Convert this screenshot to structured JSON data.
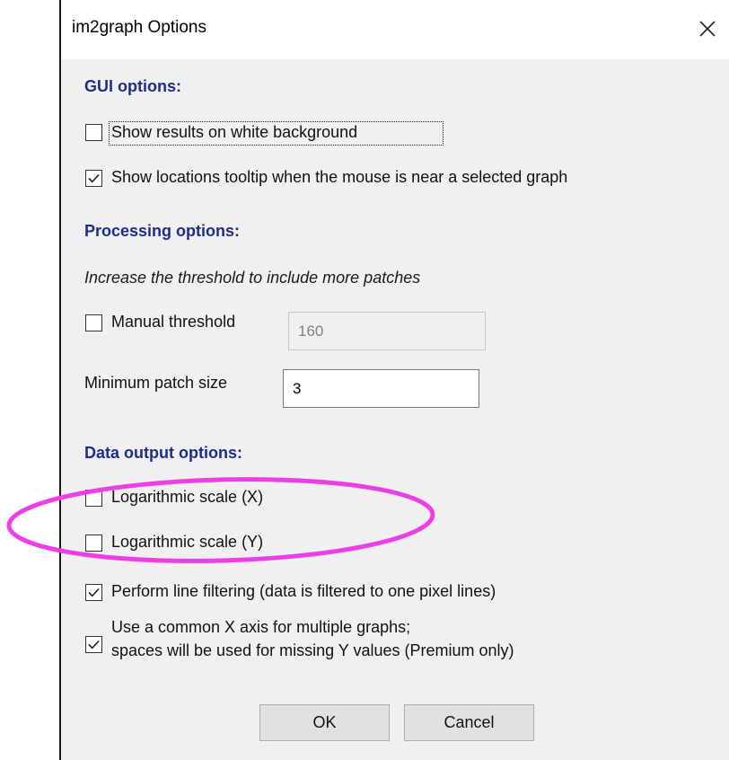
{
  "window": {
    "title": "im2graph Options",
    "close_icon": "close-icon"
  },
  "gui_options": {
    "heading": "GUI options:",
    "white_background": {
      "label": "Show results on white background",
      "checked": false
    },
    "locations_tooltip": {
      "label": "Show locations tooltip when the mouse is near a selected graph",
      "checked": true
    }
  },
  "processing_options": {
    "heading": "Processing options:",
    "note": "Increase the threshold to include more patches",
    "manual_threshold": {
      "label": "Manual threshold",
      "checked": false,
      "value": "160"
    },
    "min_patch_size": {
      "label": "Minimum patch size",
      "value": "3"
    }
  },
  "data_output_options": {
    "heading": "Data output options:",
    "log_x": {
      "label": "Logarithmic scale (X)",
      "checked": false
    },
    "log_y": {
      "label": "Logarithmic scale (Y)",
      "checked": false
    },
    "line_filtering": {
      "label": "Perform line filtering (data is filtered to one pixel lines)",
      "checked": true
    },
    "common_x_axis": {
      "label_line1": "Use a common X axis for multiple graphs;",
      "label_line2": "spaces will be used for missing Y values (Premium only)",
      "checked": true
    }
  },
  "buttons": {
    "ok": "OK",
    "cancel": "Cancel"
  },
  "colors": {
    "heading": "#1d2e8a",
    "annotation_ellipse": "#ee3fe6",
    "dialog_bg": "#f0f0f0"
  }
}
